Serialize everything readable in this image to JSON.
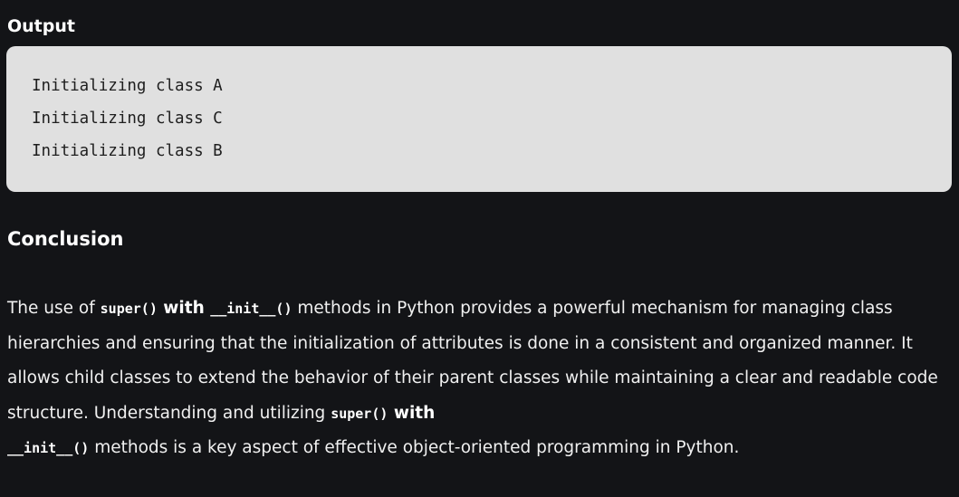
{
  "output": {
    "heading": "Output",
    "lines": [
      "Initializing class A",
      "Initializing class C",
      "Initializing class B"
    ]
  },
  "conclusion": {
    "heading": "Conclusion",
    "paragraph": {
      "t1": "The use of ",
      "c1": "super()",
      "w1": " with ",
      "c2": "__init__()",
      "t2": " methods in Python provides a powerful mechanism for managing class hierarchies and ensuring that the initialization of attributes is done in a consistent and organized manner. It allows child classes to extend the behavior of their parent classes while maintaining a clear and readable code structure. Understanding and utilizing ",
      "c3": "super()",
      "w2": " with ",
      "c4": "__init__()",
      "t3": " methods is a key aspect of effective object-oriented programming in Python."
    }
  }
}
